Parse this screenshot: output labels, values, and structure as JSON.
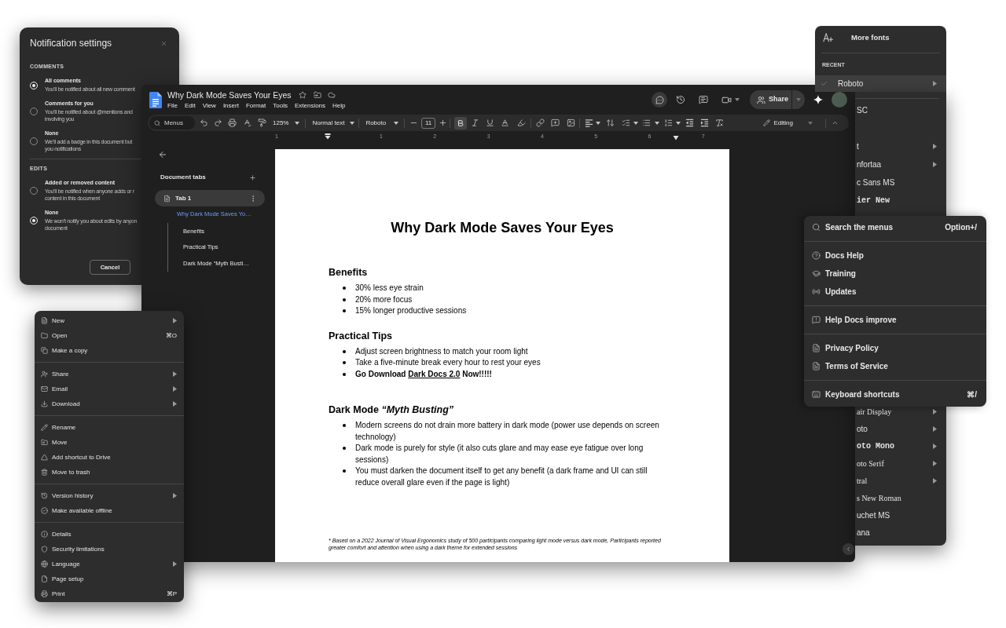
{
  "notification_panel": {
    "title": "Notification settings",
    "sections": [
      {
        "heading": "COMMENTS",
        "options": [
          {
            "label": "All comments",
            "description": [
              "You’ll be notified about all new comment"
            ],
            "selected": true
          },
          {
            "label": "Comments for you",
            "description": [
              "You’ll be notified about @mentions and",
              "involving you"
            ],
            "selected": false
          },
          {
            "label": "None",
            "description": [
              "We’ll add a badge in this document but",
              "you notifications"
            ],
            "selected": false
          }
        ]
      },
      {
        "heading": "EDITS",
        "options": [
          {
            "label": "Added or removed content",
            "description": [
              "You’ll be notified when anyone adds or r",
              "content in this document"
            ],
            "selected": false
          },
          {
            "label": "None",
            "description": [
              "We won’t notify you about edits by anyon",
              "document"
            ],
            "selected": true
          }
        ]
      }
    ],
    "cancel": "Cancel"
  },
  "docs": {
    "title": "Why Dark Mode Saves Your Eyes",
    "menu_bar": [
      "File",
      "Edit",
      "View",
      "Insert",
      "Format",
      "Tools",
      "Extensions",
      "Help"
    ],
    "share": "Share",
    "toolbar": {
      "search": {
        "placeholder": "Menus"
      },
      "zoom": "125%",
      "style": "Normal text",
      "font": "Roboto",
      "font_size": "11",
      "bold_on": true,
      "mode": "Editing"
    },
    "ruler": [
      "1",
      "1",
      "2",
      "3",
      "4",
      "5",
      "6",
      "7"
    ],
    "sidebar": {
      "heading": "Document tabs",
      "tabs": [
        {
          "label": "Tab 1",
          "selected": true,
          "outline": [
            {
              "label": "Why Dark Mode Saves Yo…",
              "selected": true,
              "children": [
                {
                  "label": "Benefits",
                  "selected": false
                },
                {
                  "label": "Practical Tips",
                  "selected": false
                },
                {
                  "label": "Dark Mode “Myth Busti…",
                  "selected": false
                }
              ]
            }
          ]
        }
      ]
    },
    "document": {
      "title": "Why Dark Mode Saves Your Eyes",
      "sections": [
        {
          "heading": "Benefits",
          "bullets": [
            {
              "kind": "text",
              "text": "30% less eye strain",
              "bold": false
            },
            {
              "kind": "text",
              "text": "20% more focus",
              "bold": false
            },
            {
              "kind": "text",
              "text": "15% longer productive sessions",
              "bold": false
            }
          ]
        },
        {
          "heading": "Practical Tips",
          "bullets": [
            {
              "kind": "text",
              "text": "Adjust screen brightness to match your room light",
              "bold": false
            },
            {
              "kind": "text",
              "text": "Take a five-minute break every hour to rest your eyes",
              "bold": false
            },
            {
              "kind": "link",
              "before": "Go Download ",
              "link": "Dark Docs 2.0",
              "after": " Now!!!!!",
              "bold": true
            }
          ]
        },
        {
          "heading": "Dark Mode *“Myth Busting”*",
          "bullets": [
            {
              "kind": "text",
              "text": "Modern screens do not drain more battery in dark mode (power use depends on screen technology)",
              "bold": false
            },
            {
              "kind": "text",
              "text": "Dark mode is purely for style (it also cuts glare and may ease eye fatigue over long sessions)",
              "bold": false
            },
            {
              "kind": "text",
              "text": "You must darken the document itself to get any benefit (a dark frame and UI can still reduce overall glare even if the page is light)",
              "bold": false
            }
          ]
        }
      ],
      "footnote": "* Based on a 2022 Journal of Visual Ergonomics study of 500 participants comparing light mode versus dark mode, Participants reported greater comfort and attention when using a dark theme for extended sessions"
    }
  },
  "file_menu": {
    "groups": [
      [
        {
          "label": "New",
          "submenu": true
        },
        {
          "label": "Open",
          "shortcut": "⌘O",
          "submenu": false
        },
        {
          "label": "Make a copy",
          "submenu": false
        }
      ],
      [
        {
          "label": "Share",
          "submenu": true
        },
        {
          "label": "Email",
          "submenu": true
        },
        {
          "label": "Download",
          "submenu": true
        }
      ],
      [
        {
          "label": "Rename",
          "submenu": false
        },
        {
          "label": "Move",
          "submenu": false
        },
        {
          "label": "Add shortcut to Drive",
          "submenu": false
        },
        {
          "label": "Move to trash",
          "submenu": false
        }
      ],
      [
        {
          "label": "Version history",
          "submenu": true
        },
        {
          "label": "Make available offline",
          "submenu": false
        }
      ],
      [
        {
          "label": "Details",
          "submenu": false
        },
        {
          "label": "Security limitations",
          "submenu": false
        },
        {
          "label": "Language",
          "submenu": true
        },
        {
          "label": "Page setup",
          "submenu": false
        },
        {
          "label": "Print",
          "shortcut": "⌘P",
          "submenu": false
        }
      ]
    ]
  },
  "font_menu": {
    "more_fonts": "More fonts",
    "recent_heading": "RECENT",
    "recent": [
      {
        "label": "Roboto",
        "selected": true,
        "submenu": true
      }
    ],
    "fonts_upper": [
      {
        "label": "SC",
        "kind": "sans",
        "submenu": false
      },
      {
        "label": "t",
        "kind": "sans",
        "submenu": true
      },
      {
        "label": "nfortaa",
        "kind": "sans",
        "submenu": true
      },
      {
        "label": "c Sans MS",
        "kind": "sans",
        "submenu": false
      },
      {
        "label": "ier New",
        "kind": "mono",
        "submenu": false
      }
    ],
    "fonts_lower": [
      {
        "label": "air Display",
        "kind": "serif",
        "submenu": true
      },
      {
        "label": "oto",
        "kind": "sans",
        "submenu": true
      },
      {
        "label": "oto Mono",
        "kind": "mono",
        "submenu": true
      },
      {
        "label": "oto Serif",
        "kind": "serif",
        "submenu": true
      },
      {
        "label": "tral",
        "kind": "serif",
        "submenu": true
      },
      {
        "label": "s New Roman",
        "kind": "serif",
        "submenu": false
      },
      {
        "label": "uchet MS",
        "kind": "sans",
        "submenu": false
      },
      {
        "label": "ana",
        "kind": "sans",
        "submenu": false
      }
    ]
  },
  "help_menu": {
    "search": {
      "label": "Search the menus",
      "shortcut": "Option+/"
    },
    "groups": [
      [
        {
          "label": "Docs Help"
        },
        {
          "label": "Training"
        },
        {
          "label": "Updates"
        }
      ],
      [
        {
          "label": "Help Docs improve"
        }
      ],
      [
        {
          "label": "Privacy Policy"
        },
        {
          "label": "Terms of Service"
        }
      ],
      [
        {
          "label": "Keyboard shortcuts",
          "shortcut": "⌘/"
        }
      ]
    ]
  }
}
